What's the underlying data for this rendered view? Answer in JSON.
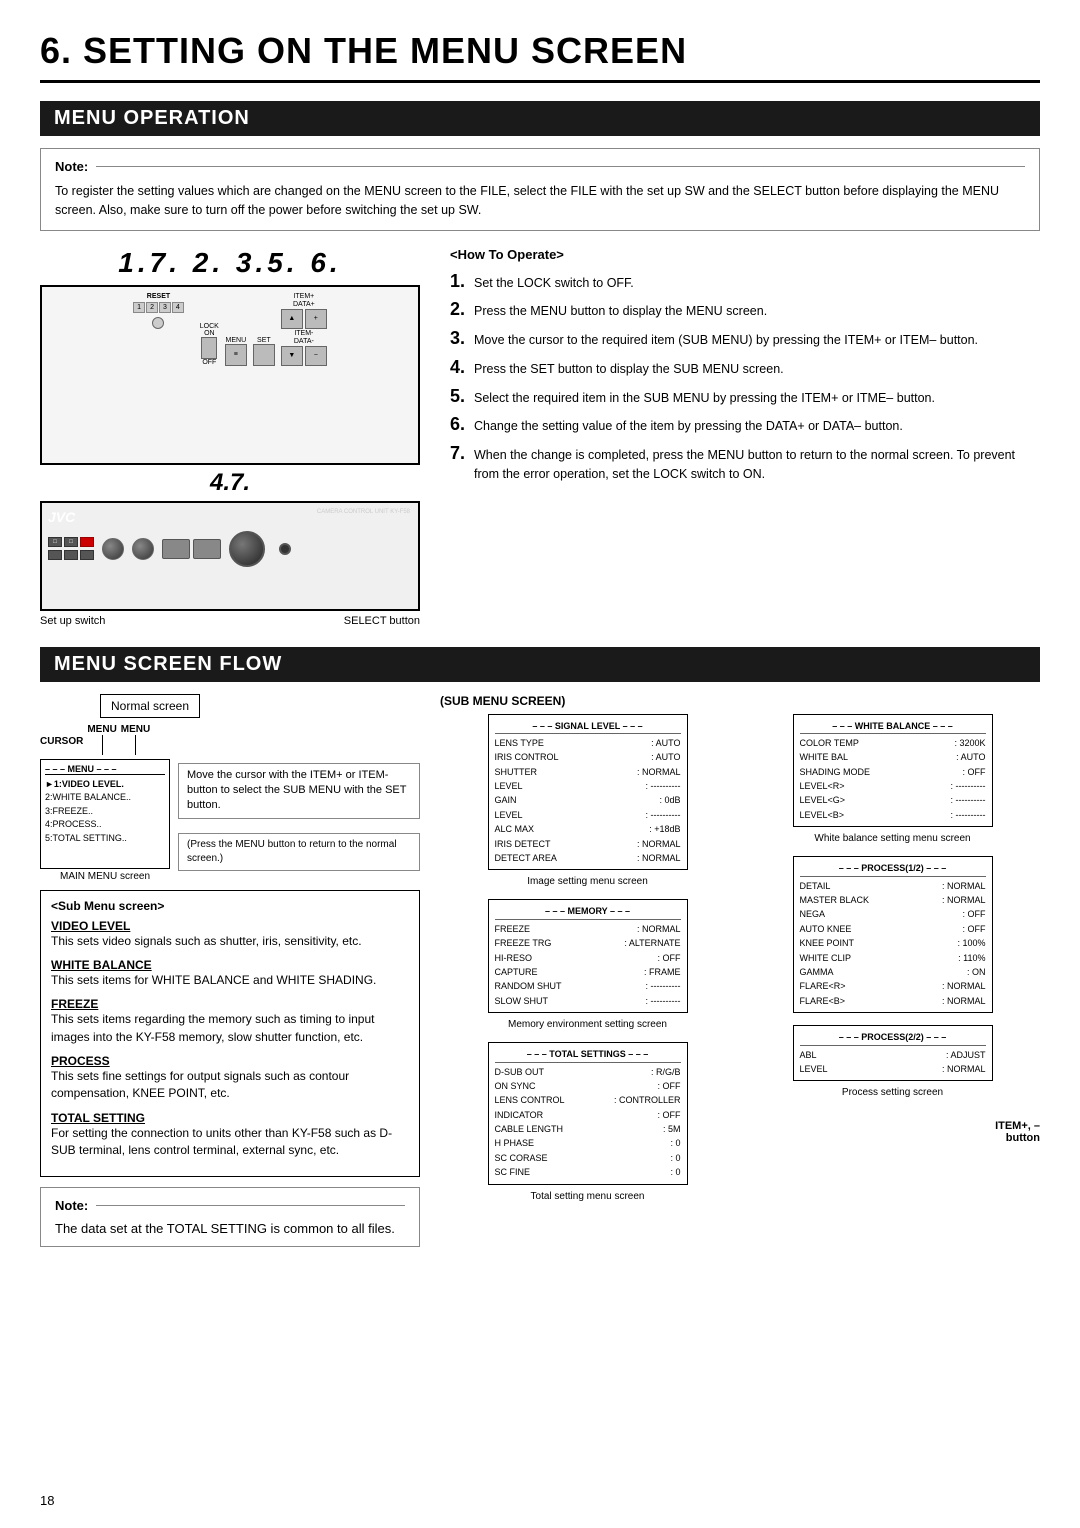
{
  "page": {
    "title": "6. SETTING ON THE MENU SCREEN",
    "page_number": "18"
  },
  "menu_operation": {
    "section_title": "MENU OPERATION",
    "note_title": "Note:",
    "note_text": "To register the setting values which are changed on the MENU screen to the FILE, select the FILE with the set up SW and the SELECT button before displaying the MENU screen. Also, make sure to turn off the power before switching the set up SW.",
    "device_numbers_top": "1.7.  2. 3.5. 6.",
    "device_numbers_bottom": "4.7.",
    "device_captions": {
      "left": "Set up switch",
      "right": "SELECT button"
    },
    "how_to_title": "<How To Operate>",
    "steps": [
      {
        "num": "1.",
        "text": "Set the LOCK switch to OFF."
      },
      {
        "num": "2.",
        "text": "Press the MENU button to display the MENU screen."
      },
      {
        "num": "3.",
        "text": "Move the cursor to the required item (SUB MENU) by pressing the ITEM+ or ITEM– button."
      },
      {
        "num": "4.",
        "text": "Press the SET button to display the SUB MENU screen."
      },
      {
        "num": "5.",
        "text": "Select the required item in the SUB MENU by pressing the ITEM+ or ITME– button."
      },
      {
        "num": "6.",
        "text": "Change the setting value of the item by pressing the DATA+ or DATA– button."
      },
      {
        "num": "7.",
        "text": "When the change is completed, press the MENU button to return to the normal screen. To prevent from the error operation, set the LOCK switch to ON."
      }
    ]
  },
  "menu_screen_flow": {
    "section_title": "MENU SCREEN FLOW",
    "normal_screen_label": "Normal screen",
    "cursor_label": "CURSOR",
    "menu_label1": "MENU",
    "menu_label2": "MENU",
    "menu_dashes": "– – – MENU – – –",
    "main_menu_items": [
      "►1:VIDEO LEVEL.",
      "2:WHITE BALANCE..",
      "3:FREEZE..",
      "4:PROCESS..",
      "5:TOTAL SETTING.."
    ],
    "main_menu_label": "MAIN MENU screen",
    "flow_desc1": "Move the cursor with the ITEM+ or ITEM- button to select the SUB MENU with the SET button.",
    "flow_desc2": "(Press the MENU button to return to the normal screen.)",
    "sub_menu_screen_title": "(SUB MENU SCREEN)",
    "sub_menu_title": "<Sub Menu screen>",
    "sub_menu_items": [
      {
        "title": "VIDEO LEVEL",
        "desc": "This sets video signals such as shutter, iris, sensitivity, etc."
      },
      {
        "title": "WHITE BALANCE",
        "desc": "This sets items for WHITE BALANCE and WHITE SHADING."
      },
      {
        "title": "FREEZE",
        "desc": "This sets items regarding the memory such as timing to input images into the KY-F58 memory, slow shutter function, etc."
      },
      {
        "title": "PROCESS",
        "desc": "This sets fine settings for output signals such as contour compensation, KNEE POINT, etc."
      },
      {
        "title": "TOTAL SETTING",
        "desc": "For setting the connection to units other than KY-F58 such as D-SUB terminal, lens control terminal, external sync, etc."
      }
    ],
    "note_bottom": "The data set at the TOTAL SETTING is common to all files.",
    "item_plus_label": "ITEM+, –\nbutton",
    "signal_level_screen": {
      "title": "– – – SIGNAL LEVEL – – –",
      "rows": [
        [
          "LENS TYPE",
          ": AUTO"
        ],
        [
          "IRIS CONTROL",
          ": AUTO"
        ],
        [
          "SHUTTER",
          ": NORMAL"
        ],
        [
          "LEVEL",
          ": ----------"
        ],
        [
          "GAIN",
          ": 0dB"
        ],
        [
          "LEVEL",
          ": ----------"
        ],
        [
          "ALC MAX",
          ": +18dB"
        ],
        [
          "IRIS DETECT",
          ": NORMAL"
        ],
        [
          "DETECT AREA",
          ": NORMAL"
        ]
      ],
      "caption": "Image setting menu screen"
    },
    "white_balance_screen": {
      "title": "– – – WHITE BALANCE – – –",
      "rows": [
        [
          "COLOR TEMP",
          ": 3200K"
        ],
        [
          "WHITE BAL",
          ": AUTO"
        ],
        [
          "SHADING MODE",
          ": OFF"
        ],
        [
          "LEVEL<R>",
          ": ----------"
        ],
        [
          "LEVEL<G>",
          ": ----------"
        ],
        [
          "LEVEL<B>",
          ": ----------"
        ]
      ],
      "caption": "White balance setting menu screen"
    },
    "memory_screen": {
      "title": "– – – MEMORY – – –",
      "rows": [
        [
          "FREEZE",
          ": NORMAL"
        ],
        [
          "FREEZE TRG",
          ": ALTERNATE"
        ],
        [
          "HI-RESO",
          ": OFF"
        ],
        [
          "CAPTURE",
          ": FRAME"
        ],
        [
          "RANDOM SHUT",
          ": ----------"
        ],
        [
          "SLOW SHUT",
          ": ----------"
        ]
      ],
      "caption": "Memory environment setting screen"
    },
    "total_settings_screen": {
      "title": "– – – TOTAL SETTINGS – – –",
      "rows": [
        [
          "D-SUB OUT",
          ": R/G/B"
        ],
        [
          "ON SYNC",
          ": OFF"
        ],
        [
          "LENS CONTROL",
          ": CONTROLLER"
        ],
        [
          "INDICATOR",
          ": OFF"
        ],
        [
          "CABLE LENGTH",
          ": 5M"
        ],
        [
          "H PHASE",
          ": 0"
        ],
        [
          "SC CORASE",
          ": 0"
        ],
        [
          "SC FINE",
          ": 0"
        ]
      ],
      "caption": "Total setting menu screen"
    },
    "process1_screen": {
      "title": "– – – PROCESS(1/2) – – –",
      "rows": [
        [
          "DETAIL",
          ": NORMAL"
        ],
        [
          "MASTER BLACK",
          ": NORMAL"
        ],
        [
          "NEGA",
          ": OFF"
        ],
        [
          "AUTO KNEE",
          ": OFF"
        ],
        [
          "KNEE POINT",
          ": 100%"
        ],
        [
          "WHITE CLIP",
          ": 110%"
        ],
        [
          "GAMMA",
          ": ON"
        ],
        [
          "FLARE<R>",
          ": NORMAL"
        ],
        [
          "FLARE<B>",
          ": NORMAL"
        ]
      ]
    },
    "process2_screen": {
      "title": "– – – PROCESS(2/2) – – –",
      "rows": [
        [
          "ABL",
          ": ADJUST"
        ],
        [
          "LEVEL",
          ": NORMAL"
        ]
      ],
      "caption": "Process setting screen"
    }
  }
}
